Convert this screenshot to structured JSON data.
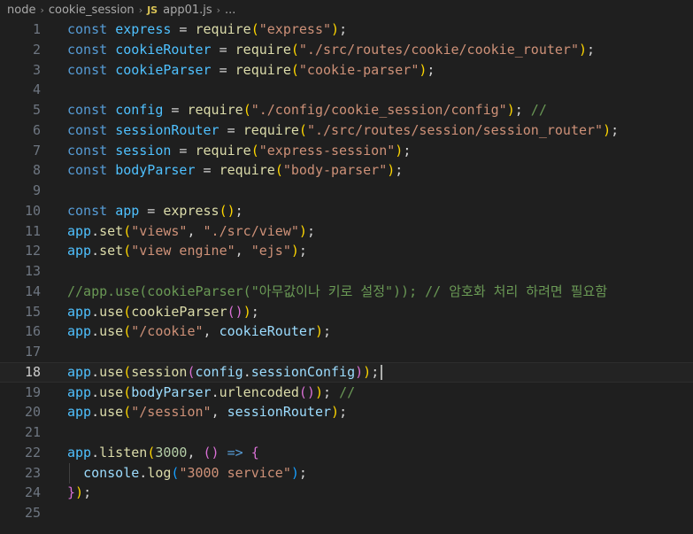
{
  "breadcrumb": {
    "items": [
      "node",
      "cookie_session",
      "app01.js",
      "..."
    ],
    "file_icon_label": "JS",
    "separator": "›"
  },
  "editor": {
    "cursor_line": 18,
    "lines": [
      {
        "n": "1",
        "tokens": [
          [
            "kw",
            "const"
          ],
          [
            "pn",
            " "
          ],
          [
            "cst",
            "express"
          ],
          [
            "pn",
            " = "
          ],
          [
            "fn",
            "require"
          ],
          [
            "br1",
            "("
          ],
          [
            "str",
            "\"express\""
          ],
          [
            "br1",
            ")"
          ],
          [
            "pn",
            ";"
          ]
        ]
      },
      {
        "n": "2",
        "tokens": [
          [
            "kw",
            "const"
          ],
          [
            "pn",
            " "
          ],
          [
            "cst",
            "cookieRouter"
          ],
          [
            "pn",
            " = "
          ],
          [
            "fn",
            "require"
          ],
          [
            "br1",
            "("
          ],
          [
            "str",
            "\"./src/routes/cookie/cookie_router\""
          ],
          [
            "br1",
            ")"
          ],
          [
            "pn",
            ";"
          ]
        ]
      },
      {
        "n": "3",
        "tokens": [
          [
            "kw",
            "const"
          ],
          [
            "pn",
            " "
          ],
          [
            "cst",
            "cookieParser"
          ],
          [
            "pn",
            " = "
          ],
          [
            "fn",
            "require"
          ],
          [
            "br1",
            "("
          ],
          [
            "str",
            "\"cookie-parser\""
          ],
          [
            "br1",
            ")"
          ],
          [
            "pn",
            ";"
          ]
        ]
      },
      {
        "n": "4",
        "tokens": []
      },
      {
        "n": "5",
        "tokens": [
          [
            "kw",
            "const"
          ],
          [
            "pn",
            " "
          ],
          [
            "cst",
            "config"
          ],
          [
            "pn",
            " = "
          ],
          [
            "fn",
            "require"
          ],
          [
            "br1",
            "("
          ],
          [
            "str",
            "\"./config/cookie_session/config\""
          ],
          [
            "br1",
            ")"
          ],
          [
            "pn",
            "; "
          ],
          [
            "cmt",
            "//"
          ]
        ]
      },
      {
        "n": "6",
        "tokens": [
          [
            "kw",
            "const"
          ],
          [
            "pn",
            " "
          ],
          [
            "cst",
            "sessionRouter"
          ],
          [
            "pn",
            " = "
          ],
          [
            "fn",
            "require"
          ],
          [
            "br1",
            "("
          ],
          [
            "str",
            "\"./src/routes/session/session_router\""
          ],
          [
            "br1",
            ")"
          ],
          [
            "pn",
            ";"
          ]
        ]
      },
      {
        "n": "7",
        "tokens": [
          [
            "kw",
            "const"
          ],
          [
            "pn",
            " "
          ],
          [
            "cst",
            "session"
          ],
          [
            "pn",
            " = "
          ],
          [
            "fn",
            "require"
          ],
          [
            "br1",
            "("
          ],
          [
            "str",
            "\"express-session\""
          ],
          [
            "br1",
            ")"
          ],
          [
            "pn",
            ";"
          ]
        ]
      },
      {
        "n": "8",
        "tokens": [
          [
            "kw",
            "const"
          ],
          [
            "pn",
            " "
          ],
          [
            "cst",
            "bodyParser"
          ],
          [
            "pn",
            " = "
          ],
          [
            "fn",
            "require"
          ],
          [
            "br1",
            "("
          ],
          [
            "str",
            "\"body-parser\""
          ],
          [
            "br1",
            ")"
          ],
          [
            "pn",
            ";"
          ]
        ]
      },
      {
        "n": "9",
        "tokens": []
      },
      {
        "n": "10",
        "tokens": [
          [
            "kw",
            "const"
          ],
          [
            "pn",
            " "
          ],
          [
            "cst",
            "app"
          ],
          [
            "pn",
            " = "
          ],
          [
            "fn",
            "express"
          ],
          [
            "br1",
            "()"
          ],
          [
            "pn",
            ";"
          ]
        ]
      },
      {
        "n": "11",
        "tokens": [
          [
            "cst",
            "app"
          ],
          [
            "pn",
            "."
          ],
          [
            "fn",
            "set"
          ],
          [
            "br1",
            "("
          ],
          [
            "str",
            "\"views\""
          ],
          [
            "pn",
            ", "
          ],
          [
            "str",
            "\"./src/view\""
          ],
          [
            "br1",
            ")"
          ],
          [
            "pn",
            ";"
          ]
        ]
      },
      {
        "n": "12",
        "tokens": [
          [
            "cst",
            "app"
          ],
          [
            "pn",
            "."
          ],
          [
            "fn",
            "set"
          ],
          [
            "br1",
            "("
          ],
          [
            "str",
            "\"view engine\""
          ],
          [
            "pn",
            ", "
          ],
          [
            "str",
            "\"ejs\""
          ],
          [
            "br1",
            ")"
          ],
          [
            "pn",
            ";"
          ]
        ]
      },
      {
        "n": "13",
        "tokens": []
      },
      {
        "n": "14",
        "tokens": [
          [
            "cmt",
            "//app.use(cookieParser(\"아무값이나 키로 설정\")); // 암호화 처리 하려면 필요함"
          ]
        ]
      },
      {
        "n": "15",
        "tokens": [
          [
            "cst",
            "app"
          ],
          [
            "pn",
            "."
          ],
          [
            "fn",
            "use"
          ],
          [
            "br1",
            "("
          ],
          [
            "fn",
            "cookieParser"
          ],
          [
            "br2",
            "()"
          ],
          [
            "br1",
            ")"
          ],
          [
            "pn",
            ";"
          ]
        ]
      },
      {
        "n": "16",
        "tokens": [
          [
            "cst",
            "app"
          ],
          [
            "pn",
            "."
          ],
          [
            "fn",
            "use"
          ],
          [
            "br1",
            "("
          ],
          [
            "str",
            "\"/cookie\""
          ],
          [
            "pn",
            ", "
          ],
          [
            "var",
            "cookieRouter"
          ],
          [
            "br1",
            ")"
          ],
          [
            "pn",
            ";"
          ]
        ]
      },
      {
        "n": "17",
        "tokens": []
      },
      {
        "n": "18",
        "tokens": [
          [
            "cst",
            "app"
          ],
          [
            "pn",
            "."
          ],
          [
            "fn",
            "use"
          ],
          [
            "br1",
            "("
          ],
          [
            "fn",
            "session"
          ],
          [
            "br2",
            "("
          ],
          [
            "var",
            "config"
          ],
          [
            "pn",
            "."
          ],
          [
            "var",
            "sessionConfig"
          ],
          [
            "br2",
            ")"
          ],
          [
            "br1",
            ")"
          ],
          [
            "pn",
            ";"
          ]
        ]
      },
      {
        "n": "19",
        "tokens": [
          [
            "cst",
            "app"
          ],
          [
            "pn",
            "."
          ],
          [
            "fn",
            "use"
          ],
          [
            "br1",
            "("
          ],
          [
            "var",
            "bodyParser"
          ],
          [
            "pn",
            "."
          ],
          [
            "fn",
            "urlencoded"
          ],
          [
            "br2",
            "()"
          ],
          [
            "br1",
            ")"
          ],
          [
            "pn",
            "; "
          ],
          [
            "cmt",
            "//"
          ]
        ]
      },
      {
        "n": "20",
        "tokens": [
          [
            "cst",
            "app"
          ],
          [
            "pn",
            "."
          ],
          [
            "fn",
            "use"
          ],
          [
            "br1",
            "("
          ],
          [
            "str",
            "\"/session\""
          ],
          [
            "pn",
            ", "
          ],
          [
            "var",
            "sessionRouter"
          ],
          [
            "br1",
            ")"
          ],
          [
            "pn",
            ";"
          ]
        ]
      },
      {
        "n": "21",
        "tokens": []
      },
      {
        "n": "22",
        "tokens": [
          [
            "cst",
            "app"
          ],
          [
            "pn",
            "."
          ],
          [
            "fn",
            "listen"
          ],
          [
            "br1",
            "("
          ],
          [
            "num",
            "3000"
          ],
          [
            "pn",
            ", "
          ],
          [
            "br2",
            "()"
          ],
          [
            "pn",
            " "
          ],
          [
            "kw",
            "=>"
          ],
          [
            "pn",
            " "
          ],
          [
            "br2",
            "{"
          ]
        ]
      },
      {
        "n": "23",
        "tokens": [
          [
            "pn",
            "  "
          ],
          [
            "var",
            "console"
          ],
          [
            "pn",
            "."
          ],
          [
            "fn",
            "log"
          ],
          [
            "br3",
            "("
          ],
          [
            "str",
            "\"3000 service\""
          ],
          [
            "br3",
            ")"
          ],
          [
            "pn",
            ";"
          ]
        ]
      },
      {
        "n": "24",
        "tokens": [
          [
            "br2",
            "}"
          ],
          [
            "br1",
            ")"
          ],
          [
            "pn",
            ";"
          ]
        ]
      },
      {
        "n": "25",
        "tokens": []
      }
    ]
  }
}
